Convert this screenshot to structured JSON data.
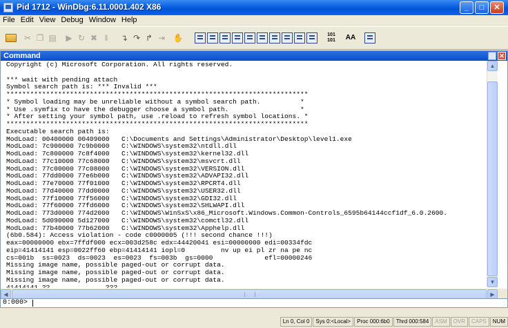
{
  "window": {
    "title": "Pid 1712 - WinDbg:6.11.0001.402 X86"
  },
  "menu": [
    "File",
    "Edit",
    "View",
    "Debug",
    "Window",
    "Help"
  ],
  "toolbar": {
    "hex_label": "101\n101",
    "font_label": "AA"
  },
  "command_window": {
    "title": "Command",
    "output": [
      "Copyright (c) Microsoft Corporation. All rights reserved.",
      "",
      "*** wait with pending attach",
      "Symbol search path is: *** Invalid ***",
      "****************************************************************************",
      "* Symbol loading may be unreliable without a symbol search path.          *",
      "* Use .symfix to have the debugger choose a symbol path.                  *",
      "* After setting your symbol path, use .reload to refresh symbol locations. *",
      "****************************************************************************",
      "Executable search path is:",
      "ModLoad: 00400000 00409000   C:\\Documents and Settings\\Administrator\\Desktop\\level1.exe",
      "ModLoad: 7c900000 7c9b0000   C:\\WINDOWS\\system32\\ntdll.dll",
      "ModLoad: 7c800000 7c8f4000   C:\\WINDOWS\\system32\\kernel32.dll",
      "ModLoad: 77c10000 77c68000   C:\\WINDOWS\\system32\\msvcrt.dll",
      "ModLoad: 77c00000 77c08000   C:\\WINDOWS\\system32\\VERSION.dll",
      "ModLoad: 77dd0000 77e6b000   C:\\WINDOWS\\system32\\ADVAPI32.dll",
      "ModLoad: 77e70000 77f01000   C:\\WINDOWS\\system32\\RPCRT4.dll",
      "ModLoad: 77d40000 77dd0000   C:\\WINDOWS\\system32\\USER32.dll",
      "ModLoad: 77f10000 77f56000   C:\\WINDOWS\\system32\\GDI32.dll",
      "ModLoad: 77f60000 77fd6000   C:\\WINDOWS\\system32\\SHLWAPI.dll",
      "ModLoad: 773d0000 774d2000   C:\\WINDOWS\\WinSxS\\x86_Microsoft.Windows.Common-Controls_6595b64144ccf1df_6.0.2600.",
      "ModLoad: 5d090000 5d127000   C:\\WINDOWS\\system32\\comctl32.dll",
      "ModLoad: 77b40000 77b62000   C:\\WINDOWS\\system32\\Apphelp.dll",
      "(6b0.584): Access violation - code c0000005 (!!! second chance !!!)",
      "eax=00000000 ebx=7ffdf000 ecx=003d258c edx=44420041 esi=00000000 edi=00334fdc",
      "eip=41414141 esp=0022ff60 ebp=41414141 iopl=0         nv up ei pl zr na pe nc",
      "cs=001b  ss=0023  ds=0023  es=0023  fs=003b  gs=0000             efl=00000246",
      "Missing image name, possible paged-out or corrupt data.",
      "Missing image name, possible paged-out or corrupt data.",
      "Missing image name, possible paged-out or corrupt data.",
      "41414141 ??              ???"
    ]
  },
  "command_input": {
    "prompt": "0:000>",
    "value": ""
  },
  "status_bar": [
    {
      "label": "Ln 0, Col 0",
      "enabled": true
    },
    {
      "label": "Sys 0:<Local>",
      "enabled": true
    },
    {
      "label": "Proc 000:6b0",
      "enabled": true
    },
    {
      "label": "Thrd 000:584",
      "enabled": true
    },
    {
      "label": "ASM",
      "enabled": false
    },
    {
      "label": "OVR",
      "enabled": false
    },
    {
      "label": "CAPS",
      "enabled": false
    },
    {
      "label": "NUM",
      "enabled": true
    }
  ]
}
